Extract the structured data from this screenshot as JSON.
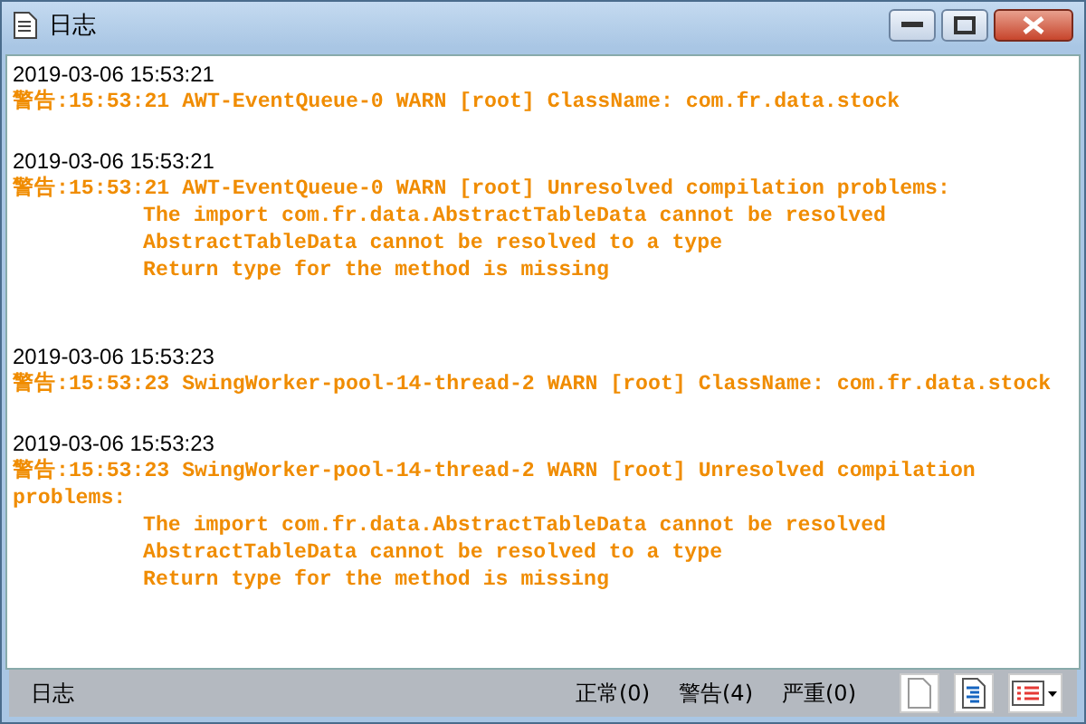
{
  "window": {
    "title": "日志"
  },
  "entries": [
    {
      "time": "2019-03-06 15:53:21",
      "message": "警告:15:53:21 AWT-EventQueue-0 WARN [root] ClassName: com.fr.data.stock"
    },
    {
      "time": "2019-03-06 15:53:21",
      "message": "警告:15:53:21 AWT-EventQueue-0 WARN [root] Unresolved compilation problems:",
      "details": [
        "The import com.fr.data.AbstractTableData cannot be resolved",
        "AbstractTableData cannot be resolved to a type",
        "Return type for the method is missing"
      ]
    },
    {
      "time": "2019-03-06 15:53:23",
      "message": "警告:15:53:23 SwingWorker-pool-14-thread-2 WARN [root] ClassName: com.fr.data.stock"
    },
    {
      "time": "2019-03-06 15:53:23",
      "message": "警告:15:53:23 SwingWorker-pool-14-thread-2 WARN [root] Unresolved compilation problems:",
      "details": [
        "The import com.fr.data.AbstractTableData cannot be resolved",
        "AbstractTableData cannot be resolved to a type",
        "Return type for the method is missing"
      ]
    }
  ],
  "status_bar": {
    "label": "日志",
    "counters": [
      "正常(0)",
      "警告(4)",
      "严重(0)"
    ]
  }
}
